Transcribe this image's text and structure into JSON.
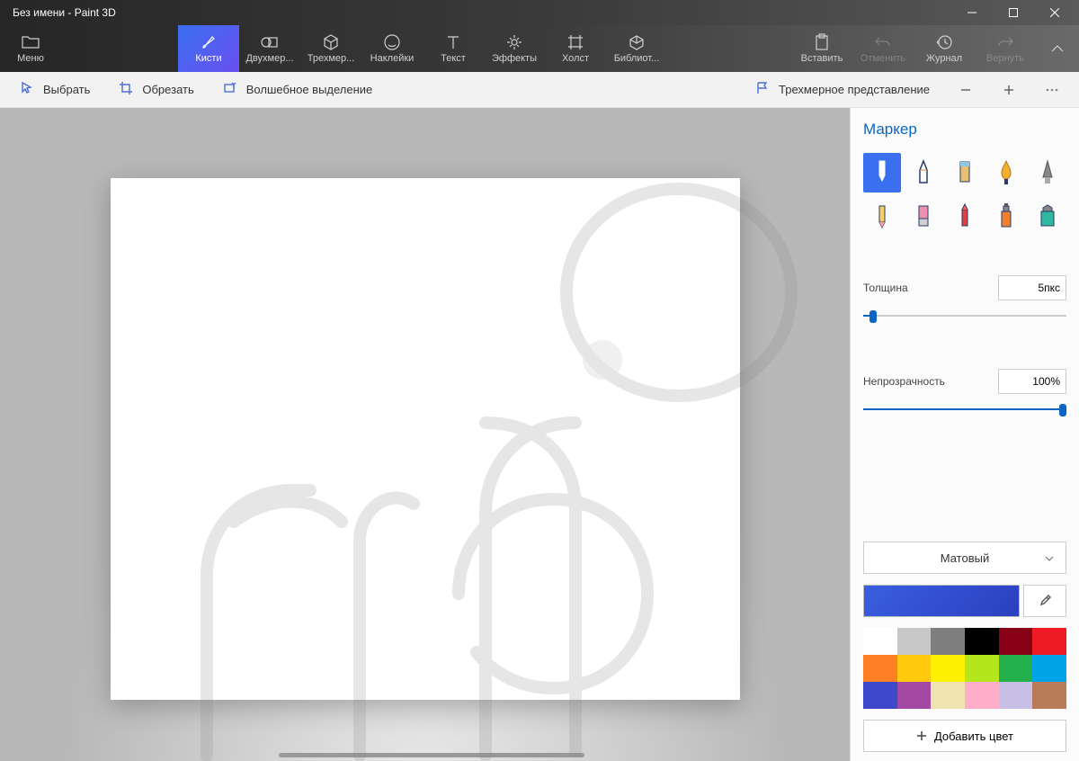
{
  "window": {
    "title": "Без имени - Paint 3D"
  },
  "ribbon": {
    "menu": "Меню",
    "tabs": [
      {
        "id": "brushes",
        "label": "Кисти",
        "active": true
      },
      {
        "id": "2d",
        "label": "Двухмер..."
      },
      {
        "id": "3d",
        "label": "Трехмер..."
      },
      {
        "id": "stickers",
        "label": "Наклейки"
      },
      {
        "id": "text",
        "label": "Текст"
      },
      {
        "id": "effects",
        "label": "Эффекты"
      },
      {
        "id": "canvas",
        "label": "Холст"
      },
      {
        "id": "library",
        "label": "Библиот..."
      }
    ],
    "right": {
      "paste": "Вставить",
      "undo": "Отменить",
      "history": "Журнал",
      "redo": "Вернуть"
    }
  },
  "toolbar": {
    "select": "Выбрать",
    "crop": "Обрезать",
    "magic": "Волшебное выделение",
    "view3d": "Трехмерное представление"
  },
  "panel": {
    "title": "Маркер",
    "thickness_label": "Толщина",
    "thickness_value": "5пкс",
    "opacity_label": "Непрозрачность",
    "opacity_value": "100%",
    "material": "Матовый",
    "add_color": "Добавить цвет",
    "slider_thickness_pct": 3,
    "slider_opacity_pct": 100
  },
  "palette": [
    "#ffffff",
    "#c8c8c8",
    "#7f7f7f",
    "#000000",
    "#880015",
    "#ed1c24",
    "#ff7f27",
    "#ffc90e",
    "#fff200",
    "#b5e61d",
    "#22b14c",
    "#00a2e8",
    "#3f48cc",
    "#a349a4",
    "#efe4b0",
    "#ffaec9",
    "#c8bfe7",
    "#b97a57"
  ],
  "brushes": [
    {
      "id": "marker",
      "sel": true
    },
    {
      "id": "calligraphy"
    },
    {
      "id": "oil"
    },
    {
      "id": "watercolor"
    },
    {
      "id": "pixel"
    },
    {
      "id": "pencil"
    },
    {
      "id": "eraser"
    },
    {
      "id": "crayon"
    },
    {
      "id": "spray"
    },
    {
      "id": "fill"
    }
  ]
}
